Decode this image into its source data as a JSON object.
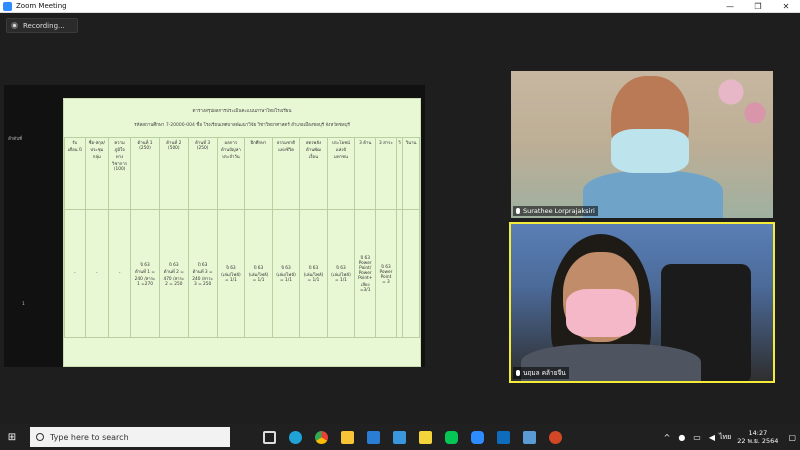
{
  "window": {
    "title": "Zoom Meeting"
  },
  "recording": {
    "label": "Recording..."
  },
  "participants": [
    {
      "name": "Surathee Lorprajaksiri"
    },
    {
      "name": "นฤมล คล้ายจีน"
    }
  ],
  "document": {
    "header1": "ตารางสรุปผลการประเมินคะแนนภาษาไทยโรงเรียน",
    "header2": "รหัสสถานศึกษา 7-20000-004   ชื่อ โรงเรียนเทศบาลพัฒนาวิจัย   วิชาวิทยาศาสตร์   อำเภอเมืองชลบุรี จังหวัดชลบุรี",
    "row_number": "1",
    "header_cells": [
      "ลำดับที่",
      "รับ\nเดือน ปี",
      "ชื่อ-สกุล/\nประชุม\nกลุ่ม",
      "ความ\nภูมิใจ\nทาง\nวิชาการ\n(100)",
      "ด้านที่ 1\n(250)",
      "ด้านที่ 2\n(500)",
      "ด้านที่ 3\n(250)",
      "ผลการ\nด้านปัญหา\nประจำวัน",
      "ฝึกศึกษา",
      "ธรรมชาติ\nแห่งชีวิต",
      "สตรพลัง\nด้านพัฒ\nเงื่อน",
      "ประโยชน์\nแห่งปั\nมหาชน",
      "3 ด้าน",
      "3 สาระ",
      "วี",
      "วินาน"
    ],
    "body_cells": [
      "1",
      "-",
      "-",
      "-",
      "ปี 63\nด้านที่ 1 =\n240 /สาระ\n1 =270",
      "ปี 63\nด้านที่ 2 =\n470 /สาระ\n2 = 250",
      "ปี 63\nด้านที่ 3 =\n240 /สาระ\n3 = 250",
      "ปี 63\n(เล่ม/ไฟล์)\n= 1/1",
      "ปี 63\n(เล่ม/ไฟล์)\n= 1/1",
      "ปี 63\n(เล่ม/ไฟล์)\n= 1/1",
      "ปี 63\n(เล่ม/ไฟล์)\n= 1/1",
      "ปี 63\n(เล่ม/ไฟล์)\n= 1/1",
      "ปี 63\nPower\nPoint/\nPower\nPoint+\nเสียง\n=3/1",
      "ปี 63\nPower\nPoint\n= 3",
      "",
      ""
    ]
  },
  "taskbar": {
    "search_placeholder": "Type here to search",
    "language": "ไทย",
    "time": "14:27",
    "date": "22 พ.ย. 2564"
  },
  "colors": {
    "accent": "#2d8cff",
    "active_speaker": "#f5ec3a",
    "doc_bg": "#e8f7d4"
  }
}
